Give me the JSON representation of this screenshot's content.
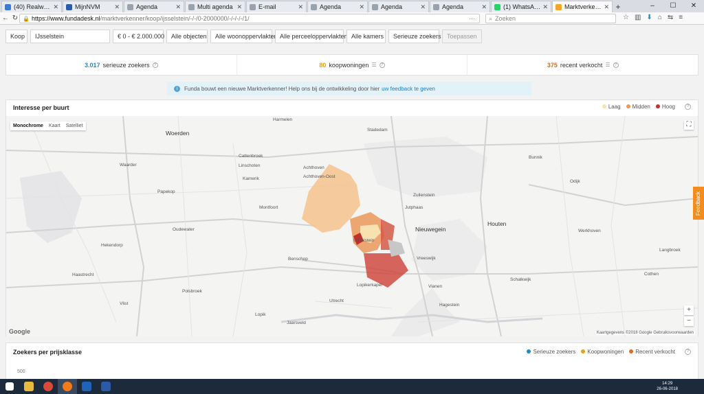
{
  "browser": {
    "tabs": [
      {
        "label": "(40) Realworks",
        "color": "#3a7bd5",
        "active": false
      },
      {
        "label": "MijnNVM",
        "color": "#2a5caa",
        "active": false
      },
      {
        "label": "Agenda",
        "color": "#9aa3ad",
        "active": false
      },
      {
        "label": "Multi agenda",
        "color": "#9aa3ad",
        "active": false
      },
      {
        "label": "E-mail",
        "color": "#9aa3ad",
        "active": false
      },
      {
        "label": "Agenda",
        "color": "#9aa3ad",
        "active": false
      },
      {
        "label": "Agenda",
        "color": "#9aa3ad",
        "active": false
      },
      {
        "label": "Agenda",
        "color": "#9aa3ad",
        "active": false
      },
      {
        "label": "(1) WhatsApp",
        "color": "#25d366",
        "active": false
      },
      {
        "label": "Marktverkenner [fu...",
        "color": "#f5a623",
        "active": true
      }
    ],
    "url_host": "https://www.fundadesk.nl",
    "url_path": "/marktverkenner/koop/ijsselstein/-/-/0-2000000/-/-/-/-/1/",
    "search_placeholder": "Zoeken"
  },
  "filters": {
    "type": "Koop",
    "location": "IJsselstein",
    "price": "€ 0 - € 2.000.000",
    "objects": "Alle objecten",
    "living_area": "Alle woonoppervlakten",
    "plot_area": "Alle perceeloppervlakten",
    "rooms": "Alle kamers",
    "seekers": "Serieuze zoekers",
    "apply": "Toepassen"
  },
  "stats": [
    {
      "num": "3.017",
      "label": "serieuze zoekers",
      "color": "#2a87c4"
    },
    {
      "num": "80",
      "label": "koopwoningen",
      "color": "#e8a21a"
    },
    {
      "num": "375",
      "label": "recent verkocht",
      "color": "#e06b1a"
    }
  ],
  "notice": {
    "text": "Funda bouwt een nieuwe Marktverkenner! Help ons bij de ontwikkeling door hier",
    "link": "uw feedback te geven"
  },
  "interest": {
    "title": "Interesse per buurt",
    "legend": [
      {
        "label": "Laag",
        "color": "#f7e1b0"
      },
      {
        "label": "Midden",
        "color": "#ea9a5a"
      },
      {
        "label": "Hoog",
        "color": "#c0312b"
      }
    ],
    "map_types": [
      "Monochrome",
      "Kaart",
      "Satelliet"
    ],
    "attribution": "Kaartgegevens ©2018 Google   Gebruiksvoorwaarden",
    "google": "Google",
    "places": [
      {
        "name": "Woerden",
        "big": true
      },
      {
        "name": "Nieuwegein",
        "big": true
      },
      {
        "name": "Houten",
        "big": true
      },
      {
        "name": "IJsselstein",
        "big": false
      },
      {
        "name": "Montfoort",
        "big": false
      },
      {
        "name": "Lopik",
        "big": false
      },
      {
        "name": "Vianen",
        "big": false
      },
      {
        "name": "Linschoten",
        "big": false
      },
      {
        "name": "Harmelen",
        "big": false
      },
      {
        "name": "Stadedam",
        "big": false
      },
      {
        "name": "Achthoven",
        "big": false
      },
      {
        "name": "Achthoven-Oost",
        "big": false
      },
      {
        "name": "Benschop",
        "big": false
      },
      {
        "name": "Polsbroek",
        "big": false
      },
      {
        "name": "Oudewater",
        "big": false
      },
      {
        "name": "Hekendorp",
        "big": false
      },
      {
        "name": "Haastrecht",
        "big": false
      },
      {
        "name": "Vlist",
        "big": false
      },
      {
        "name": "Utrecht",
        "big": false
      },
      {
        "name": "Lopikerkapel",
        "big": false
      },
      {
        "name": "Jutphaas",
        "big": false
      },
      {
        "name": "Zuilenstein",
        "big": false
      },
      {
        "name": "Vreeswijk",
        "big": false
      },
      {
        "name": "Hagestein",
        "big": false
      },
      {
        "name": "Schalkwijk",
        "big": false
      },
      {
        "name": "Cothen",
        "big": false
      },
      {
        "name": "Werkhoven",
        "big": false
      },
      {
        "name": "Odijk",
        "big": false
      },
      {
        "name": "Bunnik",
        "big": false
      },
      {
        "name": "Waarder",
        "big": false
      },
      {
        "name": "Papekop",
        "big": false
      },
      {
        "name": "Cattenbroek",
        "big": false
      },
      {
        "name": "Kamerik",
        "big": false
      },
      {
        "name": "Jaarsveld",
        "big": false
      },
      {
        "name": "Langbroek",
        "big": false
      }
    ]
  },
  "prices": {
    "title": "Zoekers per prijsklasse",
    "legend": [
      {
        "label": "Serieuze zoekers",
        "color": "#2a87c4"
      },
      {
        "label": "Koopwoningen",
        "color": "#e8a21a"
      },
      {
        "label": "Recent verkocht",
        "color": "#e06b1a"
      }
    ],
    "y_tick": "500"
  },
  "feedback_label": "Feedback",
  "taskbar": {
    "time": "14:29",
    "date": "26-06-2018"
  }
}
